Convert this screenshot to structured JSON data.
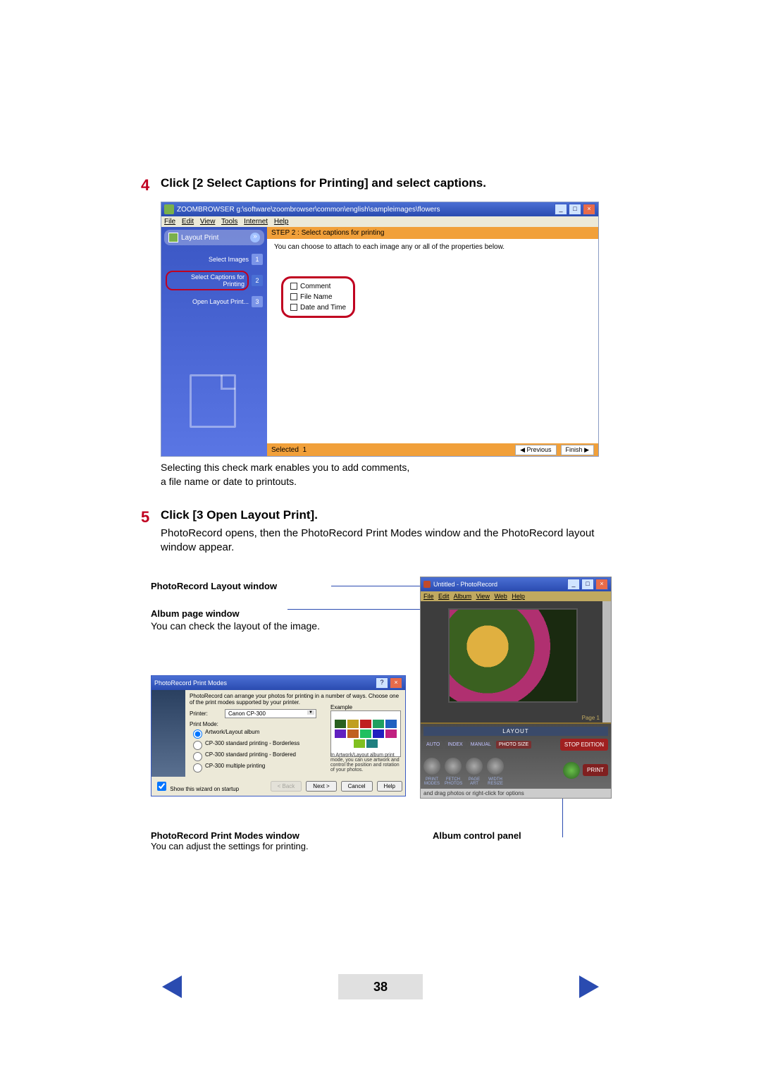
{
  "step4": {
    "number": "4",
    "title": "Click [2 Select Captions for Printing] and select captions.",
    "caption_line1": "Selecting this check mark enables you to add comments,",
    "caption_line2": "a file name or date to printouts."
  },
  "zb": {
    "title_path": "ZOOMBROWSER g:\\software\\zoombrowser\\common\\english\\sampleimages\\flowers",
    "menu": {
      "file": "File",
      "edit": "Edit",
      "view": "View",
      "tools": "Tools",
      "internet": "Internet",
      "help": "Help"
    },
    "side_header": "Layout Print",
    "side_arrow": "»",
    "steps": {
      "s1": {
        "label": "Select Images",
        "num": "1"
      },
      "s2": {
        "label": "Select Captions for Printing",
        "num": "2"
      },
      "s3": {
        "label": "Open Layout Print...",
        "num": "3"
      }
    },
    "main_header": "STEP 2 : Select captions for printing",
    "main_text": "You can choose to attach to each image any or all of the properties below.",
    "checks": {
      "c1": "Comment",
      "c2": "File Name",
      "c3": "Date and Time"
    },
    "footer": {
      "selected": "Selected",
      "count": "1",
      "previous": "Previous",
      "finish": "Finish",
      "left": "◀",
      "right": "▶"
    },
    "ctrl_min": "_",
    "ctrl_max": "□",
    "ctrl_close": "×"
  },
  "step5": {
    "number": "5",
    "title": "Click [3 Open Layout Print].",
    "text": "PhotoRecord opens, then the PhotoRecord Print Modes window and the PhotoRecord layout window appear."
  },
  "labels": {
    "layout_window": "PhotoRecord Layout window",
    "album_page": "Album page window",
    "album_page_desc": "You can check the layout of the image.",
    "print_modes": "PhotoRecord Print Modes window",
    "print_modes_desc": "You can adjust the settings for printing.",
    "album_control": "Album control panel"
  },
  "pr_layout": {
    "title": "Untitled - PhotoRecord",
    "menu": {
      "file": "File",
      "edit": "Edit",
      "album": "Album",
      "view": "View",
      "web": "Web",
      "help": "Help"
    },
    "page_label": "Page 1",
    "layout_bar": "LAYOUT",
    "tabs": {
      "auto": "AUTO",
      "index": "INDEX",
      "manual": "MANUAL",
      "photosize": "PHOTO SIZE"
    },
    "big_btn": "STOP EDITION",
    "knobs": {
      "k1": "PRINT MODES",
      "k2": "FETCH PHOTOS",
      "k3": "PAGE ART",
      "k4": "WIDTH RESIZE"
    },
    "print": "PRINT",
    "hint": "and drag photos or right-click for options",
    "ctrl_min": "_",
    "ctrl_max": "□",
    "ctrl_close": "×"
  },
  "pr_modes": {
    "title": "PhotoRecord Print Modes",
    "intro": "PhotoRecord can arrange your photos for printing in a number of ways. Choose one of the print modes supported by your printer.",
    "printer_label": "Printer:",
    "printer_value": "Canon CP-300",
    "example": "Example",
    "mode_label": "Print Mode:",
    "r1": "Artwork/Layout album",
    "r2": "CP-300 standard printing - Borderless",
    "r3": "CP-300 standard printing - Bordered",
    "r4": "CP-300 multiple printing",
    "note": "In Artwork/Layout album print mode, you can use artwork and control the position and rotation of your photos.",
    "show": "Show this wizard on startup",
    "back": "< Back",
    "next": "Next >",
    "cancel": "Cancel",
    "help": "Help",
    "ctrl_help": "?",
    "ctrl_close": "×"
  },
  "page_number": "38"
}
